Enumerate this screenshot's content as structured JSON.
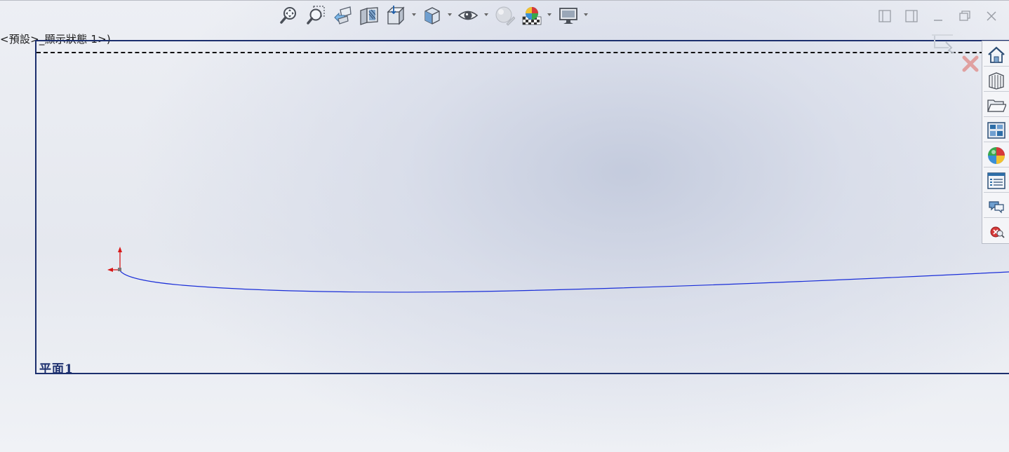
{
  "breadcrumb": {
    "text": "<預設>_顯示狀態 1>)"
  },
  "sketch": {
    "plane_label": "平面1"
  },
  "toolbar": {
    "items": [
      {
        "icon": "zoom-to-fit-icon"
      },
      {
        "icon": "zoom-to-area-icon"
      },
      {
        "icon": "previous-view-icon"
      },
      {
        "icon": "section-view-icon"
      },
      {
        "icon": "view-orientation-icon"
      },
      {
        "icon": "display-style-icon"
      },
      {
        "icon": "hide-show-items-icon"
      },
      {
        "icon": "edit-appearance-icon"
      },
      {
        "icon": "apply-scene-icon"
      },
      {
        "icon": "view-settings-icon"
      }
    ]
  },
  "window_controls": [
    "tile-left-icon",
    "tile-right-icon",
    "minimize-icon",
    "restore-icon",
    "close-icon"
  ],
  "task_pane": {
    "items": [
      "home-icon",
      "design-library-icon",
      "file-explorer-icon",
      "view-palette-icon",
      "appearances-icon",
      "custom-properties-icon",
      "forum-icon",
      "solidworks-resources-icon"
    ]
  },
  "colors": {
    "plane_border": "#1c2f6e",
    "curve": "#1a2ed8",
    "origin": "#d81818",
    "cancel": "#e0a0a0"
  }
}
